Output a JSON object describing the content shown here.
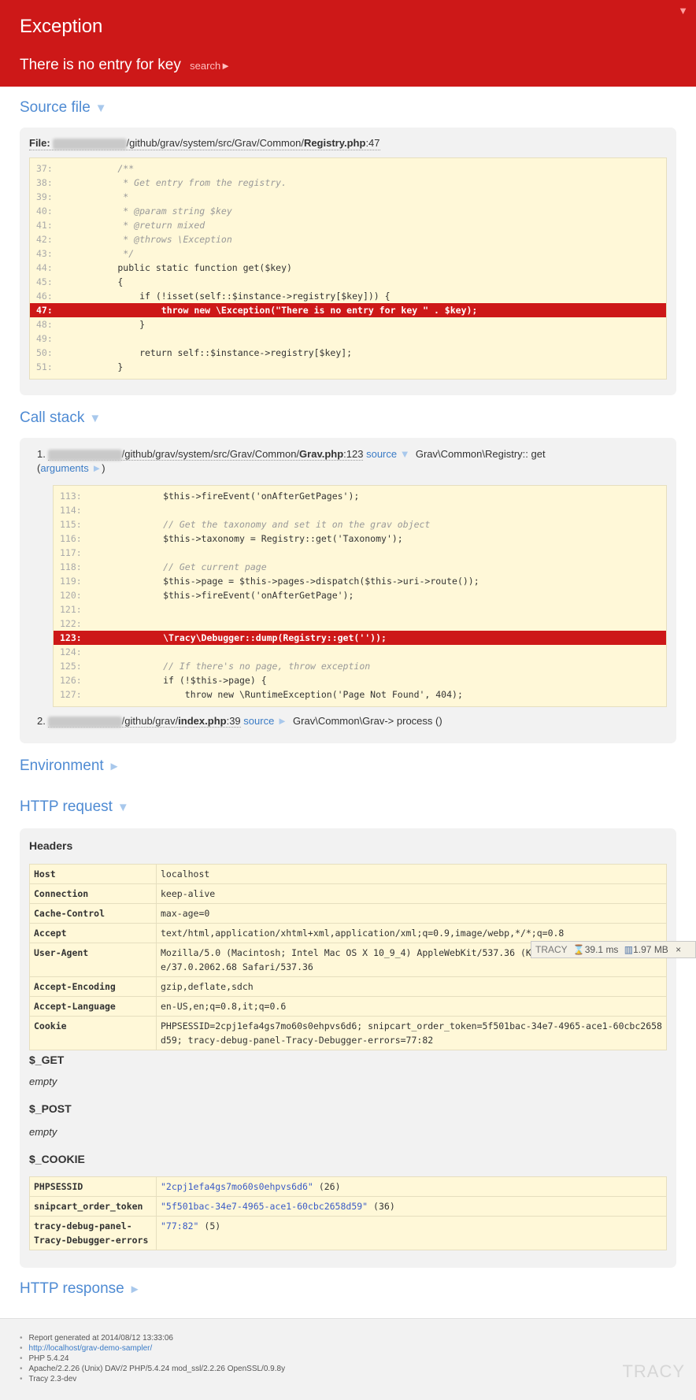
{
  "header": {
    "title": "Exception",
    "message": "There is no entry for key",
    "search_label": "search►",
    "collapse_glyph": "▼"
  },
  "sections": {
    "source_file": "Source file",
    "call_stack": "Call stack",
    "environment": "Environment",
    "http_request": "HTTP request",
    "http_response": "HTTP response"
  },
  "source_file": {
    "label": "File:",
    "blurred": "/Users/xxxxxxxx",
    "path": "/github/grav/system/src/Grav/Common/",
    "filename": "Registry.php",
    "line": ":47",
    "code_lines": [
      {
        "num": "37:",
        "text": "        /**"
      },
      {
        "num": "38:",
        "text": "         * Get entry from the registry."
      },
      {
        "num": "39:",
        "text": "         *"
      },
      {
        "num": "40:",
        "text": "         * @param string $key"
      },
      {
        "num": "41:",
        "text": "         * @return mixed"
      },
      {
        "num": "42:",
        "text": "         * @throws \\Exception"
      },
      {
        "num": "43:",
        "text": "         */"
      },
      {
        "num": "44:",
        "text": "        public static function get($key)"
      },
      {
        "num": "45:",
        "text": "        {"
      },
      {
        "num": "46:",
        "text": "            if (!isset(self::$instance->registry[$key])) {"
      },
      {
        "num": "47:",
        "text": "                throw new \\Exception(\"There is no entry for key \" . $key);"
      },
      {
        "num": "48:",
        "text": "            }"
      },
      {
        "num": "49:",
        "text": ""
      },
      {
        "num": "50:",
        "text": "            return self::$instance->registry[$key];"
      },
      {
        "num": "51:",
        "text": "        }"
      }
    ]
  },
  "call_stack": {
    "item1": {
      "num": "1.",
      "blurred": "/Users/xxxxxxxx",
      "path": "/github/grav/system/src/Grav/Common/",
      "filename": "Grav.php",
      "line": ":123",
      "source_label": "source",
      "source_arrow": "▼",
      "function": "Grav\\Common\\Registry:: get",
      "args_open": "(",
      "args_label": "arguments",
      "args_arrow": "►",
      "args_close": ")",
      "code_lines": [
        {
          "num": "113:",
          "text": "            $this->fireEvent('onAfterGetPages');"
        },
        {
          "num": "114:",
          "text": ""
        },
        {
          "num": "115:",
          "text": "            // Get the taxonomy and set it on the grav object"
        },
        {
          "num": "116:",
          "text": "            $this->taxonomy = Registry::get('Taxonomy');"
        },
        {
          "num": "117:",
          "text": ""
        },
        {
          "num": "118:",
          "text": "            // Get current page"
        },
        {
          "num": "119:",
          "text": "            $this->page = $this->pages->dispatch($this->uri->route());"
        },
        {
          "num": "120:",
          "text": "            $this->fireEvent('onAfterGetPage');"
        },
        {
          "num": "121:",
          "text": ""
        },
        {
          "num": "122:",
          "text": ""
        },
        {
          "num": "123:",
          "text": "            \\Tracy\\Debugger::dump(Registry::get(''));"
        },
        {
          "num": "124:",
          "text": ""
        },
        {
          "num": "125:",
          "text": "            // If there's no page, throw exception"
        },
        {
          "num": "126:",
          "text": "            if (!$this->page) {"
        },
        {
          "num": "127:",
          "text": "                throw new \\RuntimeException('Page Not Found', 404);"
        }
      ]
    },
    "item2": {
      "num": "2.",
      "blurred": "/Users/xxxxxxxx",
      "path": "/github/grav/",
      "filename": "index.php",
      "line": ":39",
      "source_label": "source",
      "source_arrow": "►",
      "function": "Grav\\Common\\Grav-> process ()"
    }
  },
  "http_request": {
    "headers_title": "Headers",
    "headers": [
      {
        "k": "Host",
        "v": "localhost"
      },
      {
        "k": "Connection",
        "v": "keep-alive"
      },
      {
        "k": "Cache-Control",
        "v": "max-age=0"
      },
      {
        "k": "Accept",
        "v": "text/html,application/xhtml+xml,application/xml;q=0.9,image/webp,*/*;q=0.8"
      },
      {
        "k": "User-Agent",
        "v": "Mozilla/5.0 (Macintosh; Intel Mac OS X 10_9_4) AppleWebKit/537.36 (KHTML, like Gecko) Chrome/37.0.2062.68 Safari/537.36"
      },
      {
        "k": "Accept-Encoding",
        "v": "gzip,deflate,sdch"
      },
      {
        "k": "Accept-Language",
        "v": "en-US,en;q=0.8,it;q=0.6"
      },
      {
        "k": "Cookie",
        "v": "PHPSESSID=2cpj1efa4gs7mo60s0ehpvs6d6; snipcart_order_token=5f501bac-34e7-4965-ace1-60cbc2658d59; tracy-debug-panel-Tracy-Debugger-errors=77:82"
      }
    ],
    "get_title": "$_GET",
    "get_empty": "empty",
    "post_title": "$_POST",
    "post_empty": "empty",
    "cookie_title": "$_COOKIE",
    "cookies": [
      {
        "k": "PHPSESSID",
        "v": "\"2cpj1efa4gs7mo60s0ehpvs6d6\"",
        "len": "(26)"
      },
      {
        "k": "snipcart_order_token",
        "v": "\"5f501bac-34e7-4965-ace1-60cbc2658d59\"",
        "len": "(36)"
      },
      {
        "k": "tracy-debug-panel-Tracy-Debugger-errors",
        "v": "\"77:82\"",
        "len": "(5)"
      }
    ]
  },
  "tracy_bar": {
    "logo": "TRACY",
    "time": "39.1 ms",
    "memory": "1.97 MB",
    "close": "×"
  },
  "footer": {
    "items": [
      "Report generated at 2014/08/12 13:33:06",
      "http://localhost/grav-demo-sampler/",
      "PHP 5.4.24",
      "Apache/2.2.26 (Unix) DAV/2 PHP/5.4.24 mod_ssl/2.2.26 OpenSSL/0.9.8y",
      "Tracy 2.3-dev"
    ],
    "logo": "TRACY"
  },
  "colors": {
    "error_red": "#cd1818",
    "link_blue": "#4f8bd3",
    "code_bg": "#fff8d8"
  }
}
